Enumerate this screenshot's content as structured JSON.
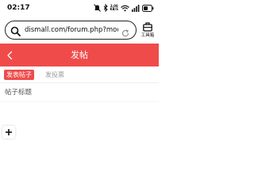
{
  "status_bar": {
    "time": "02:17",
    "network_speed_value": "3.00",
    "network_speed_unit": "KB/S",
    "icons": [
      "silent-icon",
      "bluetooth-icon",
      "network-speed",
      "wifi-icon",
      "signal-icon",
      "battery-icon"
    ]
  },
  "browser": {
    "url": "dismall.com/forum.php?mod=p...",
    "toolbox_label": "工具箱",
    "icons": [
      "search-icon",
      "reload-icon",
      "toolbox-icon"
    ]
  },
  "header": {
    "title": "发帖",
    "back_icon": "chevron-left-icon",
    "background_color": "#f04b4b"
  },
  "tabs": [
    {
      "label": "发表帖子",
      "active": true
    },
    {
      "label": "发投票",
      "active": false
    }
  ],
  "form": {
    "title_placeholder": "帖子标题"
  },
  "add_button_icon": "plus-icon",
  "colors": {
    "accent": "#f04b4b",
    "inactive_tab_text": "#999999"
  }
}
